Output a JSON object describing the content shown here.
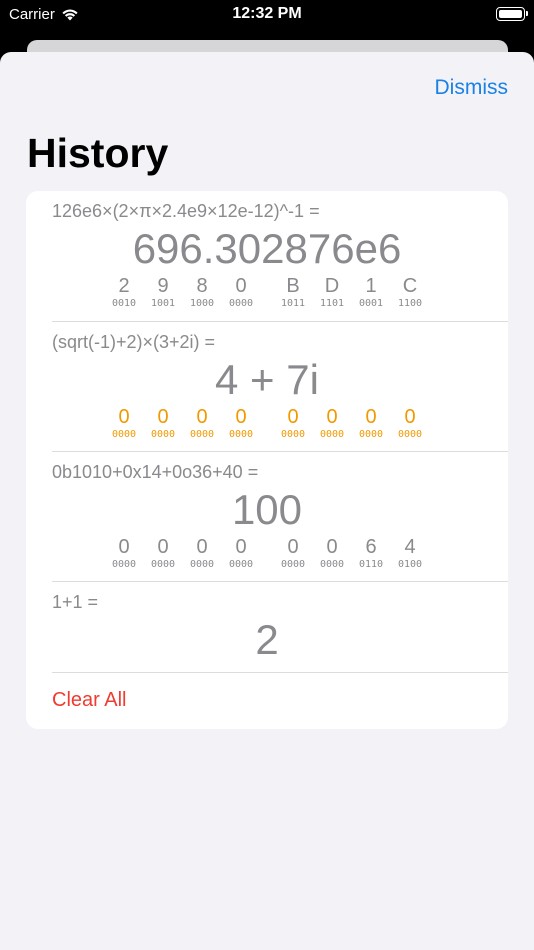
{
  "status": {
    "carrier": "Carrier",
    "time": "12:32 PM",
    "battery_level": 1.0
  },
  "header": {
    "dismiss_label": "Dismiss",
    "title": "History"
  },
  "entries": [
    {
      "expression": "126e6×(2×π×2.4e9×12e-12)^-1 =",
      "result": "696.302876e6",
      "color": "gray",
      "nibbles": [
        {
          "d": "2",
          "b": "0010"
        },
        {
          "d": "9",
          "b": "1001"
        },
        {
          "d": "8",
          "b": "1000"
        },
        {
          "d": "0",
          "b": "0000"
        },
        {
          "d": "B",
          "b": "1011"
        },
        {
          "d": "D",
          "b": "1101"
        },
        {
          "d": "1",
          "b": "0001"
        },
        {
          "d": "C",
          "b": "1100"
        }
      ]
    },
    {
      "expression": "(sqrt(-1)+2)×(3+2i) =",
      "result": "4 + 7i",
      "color": "orange",
      "nibbles": [
        {
          "d": "0",
          "b": "0000"
        },
        {
          "d": "0",
          "b": "0000"
        },
        {
          "d": "0",
          "b": "0000"
        },
        {
          "d": "0",
          "b": "0000"
        },
        {
          "d": "0",
          "b": "0000"
        },
        {
          "d": "0",
          "b": "0000"
        },
        {
          "d": "0",
          "b": "0000"
        },
        {
          "d": "0",
          "b": "0000"
        }
      ]
    },
    {
      "expression": "0b1010+0x14+0o36+40 =",
      "result": "100",
      "color": "gray",
      "nibbles": [
        {
          "d": "0",
          "b": "0000"
        },
        {
          "d": "0",
          "b": "0000"
        },
        {
          "d": "0",
          "b": "0000"
        },
        {
          "d": "0",
          "b": "0000"
        },
        {
          "d": "0",
          "b": "0000"
        },
        {
          "d": "0",
          "b": "0000"
        },
        {
          "d": "6",
          "b": "0110"
        },
        {
          "d": "4",
          "b": "0100"
        }
      ]
    },
    {
      "expression": "1+1 =",
      "result": "2",
      "color": "gray",
      "nibbles": []
    }
  ],
  "footer": {
    "clear_all_label": "Clear All"
  },
  "colors": {
    "accent": "#1a82e6",
    "destructive": "#ef3b30",
    "imaginary": "#f09a00",
    "secondary_text": "#8a8a8e"
  }
}
